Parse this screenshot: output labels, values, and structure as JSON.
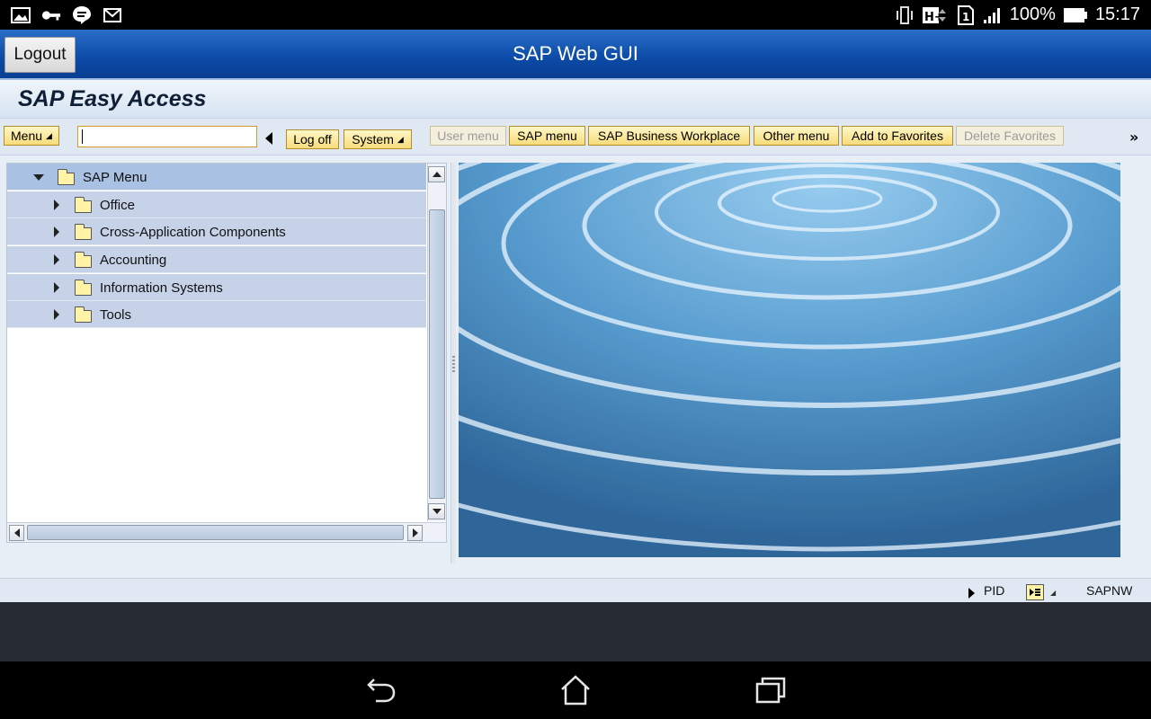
{
  "status_bar": {
    "battery": "100%",
    "time": "15:17",
    "left_icons": [
      "gallery-icon",
      "key-icon",
      "chat-icon",
      "mail-icon"
    ],
    "right_icons": [
      "vibrate-icon",
      "hplus-icon",
      "sim-icon",
      "signal-icon",
      "battery-icon"
    ],
    "network_badge": "H+",
    "sim_badge": "1"
  },
  "titlebar": {
    "logout_label": "Logout",
    "title": "SAP Web GUI"
  },
  "sap_header": {
    "title": "SAP Easy Access"
  },
  "toolbar": {
    "menu_label": "Menu",
    "command_value": "",
    "logoff_label": "Log off",
    "system_label": "System",
    "buttons": [
      {
        "label": "User menu",
        "enabled": false
      },
      {
        "label": "SAP menu",
        "enabled": true
      },
      {
        "label": "SAP Business Workplace",
        "enabled": true
      },
      {
        "label": "Other menu",
        "enabled": true
      },
      {
        "label": "Add to Favorites",
        "enabled": true
      },
      {
        "label": "Delete Favorites",
        "enabled": false
      }
    ],
    "more_label": "»"
  },
  "tree": {
    "root": "SAP Menu",
    "items": [
      {
        "label": "Office"
      },
      {
        "label": "Cross-Application Components"
      },
      {
        "label": "Accounting"
      },
      {
        "label": "Information Systems"
      },
      {
        "label": "Tools"
      }
    ]
  },
  "status": {
    "pid_label": "PID",
    "system_name": "SAPNW"
  },
  "colors": {
    "title_blue": "#0b4aa6",
    "button_yellow": "#f6dc7a",
    "tree_selected": "#c5d2e8",
    "header_bg": "#d6e3f1"
  }
}
